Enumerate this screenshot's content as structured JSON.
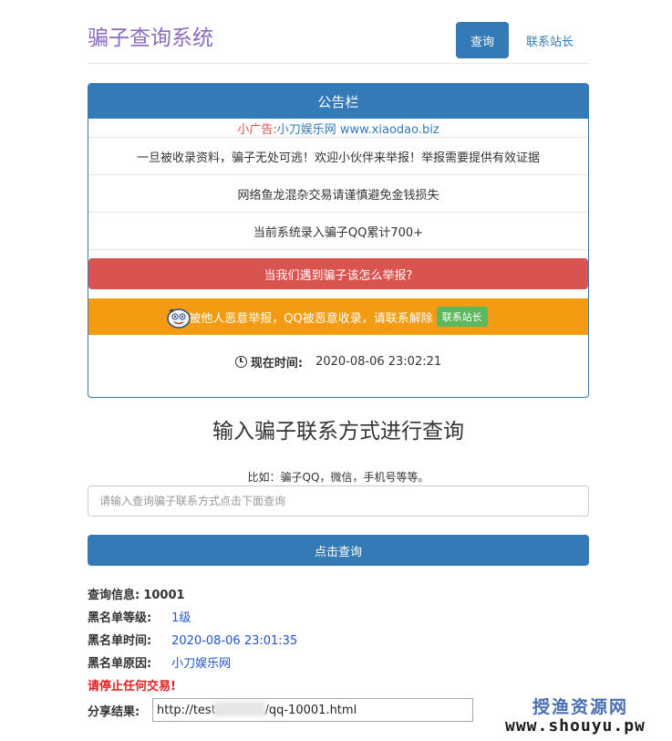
{
  "header": {
    "title": "骗子查询系统",
    "nav_query": "查询",
    "nav_contact": "联系站长"
  },
  "notice": {
    "heading": "公告栏",
    "ad_label": "小广告:",
    "ad_text": " 小刀娱乐网 www.xiaodao.biz",
    "lines": [
      "一旦被收录资料，骗子无处可逃！欢迎小伙伴来举报！举报需要提供有效证据",
      "网络鱼龙混杂交易请谨慎避免金钱损失",
      "当前系统录入骗子QQ累计700+"
    ],
    "report_button": "当我们遇到骗子该怎么举报?",
    "malicious_text": "被他人恶意举报，QQ被恶意收录，请联系解除",
    "contact_badge": "联系站长",
    "time_label": "现在时间:",
    "time_value": "2020-08-06 23:02:21"
  },
  "search": {
    "title": "输入骗子联系方式进行查询",
    "example": "比如：骗子QQ，微信，手机号等等。",
    "placeholder": "请输入查询骗子联系方式点击下面查询",
    "button": "点击查询"
  },
  "result": {
    "info_label": "查询信息:",
    "info_value": "10001",
    "level_label": "黑名单等级:",
    "level_value": "1级",
    "time_label": "黑名单时间:",
    "time_value": "2020-08-06 23:01:35",
    "reason_label": "黑名单原因:",
    "reason_value": "小刀娱乐网",
    "warning": "请停止任何交易!",
    "share_label": "分享结果:",
    "share_value": "http://test.            /qq-10001.html"
  },
  "watermark": {
    "name": "授渔资源网",
    "url": "www.shouyu.pw"
  },
  "colors": {
    "primary": "#337ab7",
    "danger": "#d9534f",
    "warning_bar": "#f39c12",
    "success": "#5cb85c",
    "title": "#8a6bbf"
  }
}
